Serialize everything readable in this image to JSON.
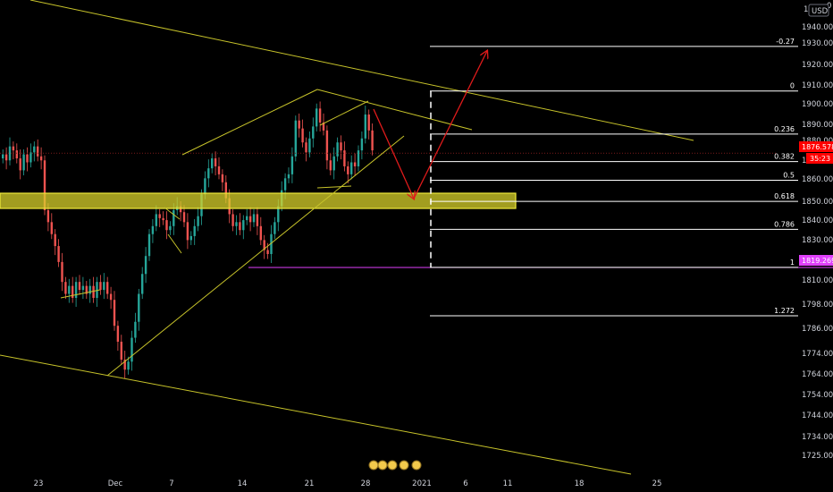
{
  "chart_data": {
    "type": "candlestick",
    "currency": "USD",
    "y_axis": {
      "labels": [
        "1940.000",
        "1930.000",
        "1920.000",
        "1910.000",
        "1900.000",
        "1890.000",
        "1880.000",
        "1860.000",
        "1850.000",
        "1840.000",
        "1830.000",
        "1810.000",
        "1798.000",
        "1786.000",
        "1774.000",
        "1764.000",
        "1754.000",
        "1744.000",
        "1734.000",
        "1725.000"
      ],
      "partial_labels": [
        "1",
        "0",
        "18"
      ],
      "min": 1720,
      "max": 1950
    },
    "x_axis": {
      "labels": [
        "23",
        "Dec",
        "7",
        "14",
        "21",
        "28",
        "2021",
        "6",
        "11",
        "18",
        "25"
      ]
    },
    "price_tags": {
      "current_price": "1876.578",
      "countdown": "35:23",
      "magenta_level": "1819.269"
    },
    "fib_levels": [
      {
        "ratio": "-0.27",
        "price": 1930.2
      },
      {
        "ratio": "0",
        "price": 1907.8
      },
      {
        "ratio": "0.236",
        "price": 1886.2
      },
      {
        "ratio": "0.382",
        "price": 1872.4
      },
      {
        "ratio": "0.5",
        "price": 1863.0
      },
      {
        "ratio": "0.618",
        "price": 1852.4
      },
      {
        "ratio": "0.786",
        "price": 1838.4
      },
      {
        "ratio": "1",
        "price": 1819.3
      },
      {
        "ratio": "1.272",
        "price": 1795.0
      }
    ],
    "candles_approx_close": [
      1876,
      1873,
      1880,
      1878,
      1874,
      1868,
      1876,
      1872,
      1877,
      1880,
      1875,
      1873,
      1848,
      1842,
      1836,
      1830,
      1822,
      1812,
      1806,
      1810,
      1804,
      1812,
      1808,
      1810,
      1806,
      1810,
      1804,
      1812,
      1808,
      1812,
      1806,
      1803,
      1790,
      1782,
      1773,
      1768,
      1772,
      1784,
      1792,
      1806,
      1816,
      1825,
      1836,
      1840,
      1846,
      1844,
      1843,
      1838,
      1840,
      1848,
      1850,
      1847,
      1842,
      1833,
      1835,
      1840,
      1845,
      1856,
      1864,
      1869,
      1874,
      1870,
      1866,
      1862,
      1854,
      1846,
      1840,
      1842,
      1838,
      1843,
      1845,
      1842,
      1846,
      1840,
      1833,
      1828,
      1826,
      1836,
      1842,
      1850,
      1858,
      1864,
      1866,
      1875,
      1893,
      1889,
      1882,
      1877,
      1884,
      1890,
      1899,
      1892,
      1888,
      1873,
      1868,
      1875,
      1882,
      1878,
      1870,
      1866,
      1872,
      1870,
      1878,
      1884,
      1896,
      1888,
      1878
    ]
  },
  "colors": {
    "background": "#000000",
    "trendline": "#c7c32a",
    "zone_fill": "#d8d22b",
    "arrow": "#e01b1b",
    "fib_line": "#ffffff",
    "up_candle": "#26a69a",
    "down_candle": "#ef5350",
    "current_price_tag": "#ff0000",
    "magenta_level": "#e040fb"
  },
  "icons": {
    "logo_badges": [
      "toolbar-badge-icon",
      "toolbar-badge-icon",
      "toolbar-badge-icon",
      "toolbar-badge-icon",
      "toolbar-badge-icon"
    ]
  }
}
